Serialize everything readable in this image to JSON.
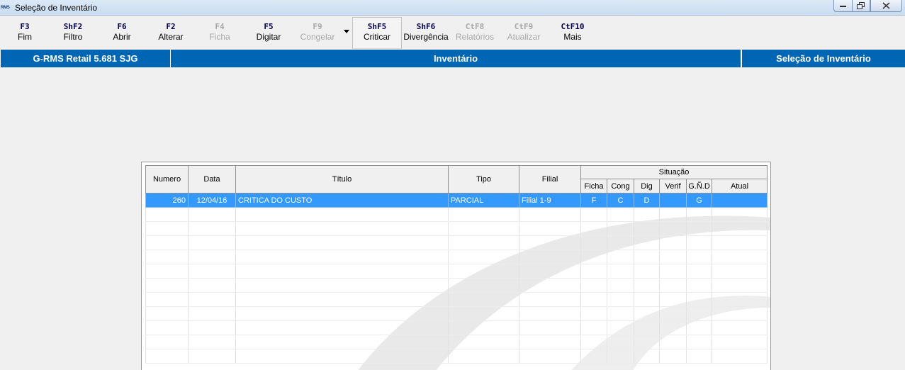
{
  "window": {
    "app_logo": "RMS",
    "title": "Seleção de Inventário"
  },
  "toolbar": [
    {
      "key": "F3",
      "label": "Fim",
      "enabled": true
    },
    {
      "key": "ShF2",
      "label": "Filtro",
      "enabled": true
    },
    {
      "key": "F6",
      "label": "Abrir",
      "enabled": true
    },
    {
      "key": "F2",
      "label": "Alterar",
      "enabled": true
    },
    {
      "key": "F4",
      "label": "Ficha",
      "enabled": false
    },
    {
      "key": "F5",
      "label": "Digitar",
      "enabled": true
    },
    {
      "key": "F9",
      "label": "Congelar",
      "enabled": false
    },
    {
      "key": "ShF5",
      "label": "Criticar",
      "enabled": true
    },
    {
      "key": "ShF6",
      "label": "Divergência",
      "enabled": true
    },
    {
      "key": "CtF8",
      "label": "Relatórios",
      "enabled": false
    },
    {
      "key": "CtF9",
      "label": "Atualizar",
      "enabled": false
    },
    {
      "key": "CtF10",
      "label": "Mais",
      "enabled": true
    }
  ],
  "statusbar": {
    "system": "G-RMS Retail 5.681 SJG",
    "module": "Inventário",
    "screen": "Seleção de Inventário"
  },
  "grid": {
    "headers": {
      "numero": "Numero",
      "data": "Data",
      "titulo": "Título",
      "tipo": "Tipo",
      "filial": "Filial",
      "situacao": "Situação",
      "ficha": "Ficha",
      "cong": "Cong",
      "dig": "Dig",
      "verif": "Verif",
      "gnd": "G.Ñ.D",
      "atual": "Atual"
    },
    "rows": [
      {
        "numero": "260",
        "data": "12/04/16",
        "titulo": "CRITICA DO CUSTO",
        "tipo": "PARCIAL",
        "filial": "Filial 1-9",
        "ficha": "F",
        "cong": "C",
        "dig": "D",
        "verif": "",
        "gnd": "G",
        "atual": ""
      }
    ]
  },
  "colors": {
    "statusbar_bg": "#0065b3",
    "selection_bg": "#3399ff",
    "key_text": "#000050",
    "disabled_text": "#a8a8a8"
  }
}
